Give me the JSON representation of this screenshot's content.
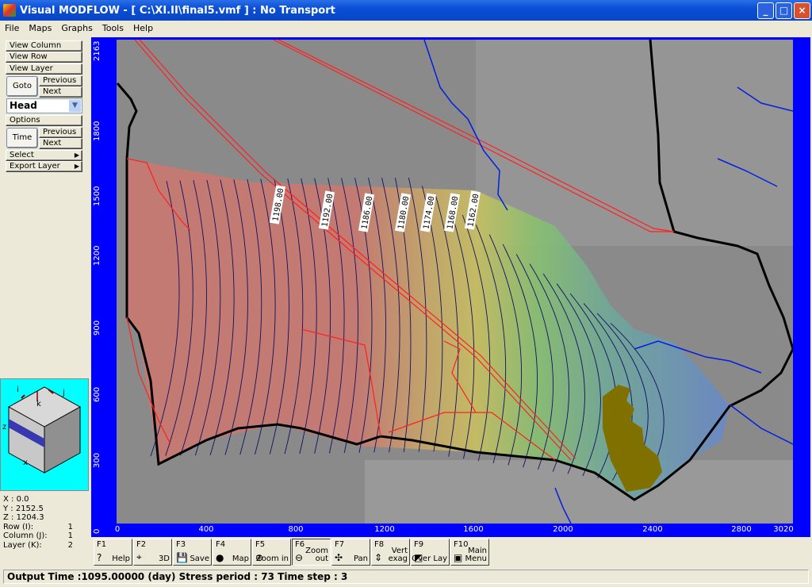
{
  "window": {
    "title": "Visual MODFLOW - [ C:\\XI.II\\final5.vmf ] : No Transport",
    "minimize": "_",
    "maximize": "□",
    "close": "×"
  },
  "menu": [
    "File",
    "Maps",
    "Graphs",
    "Tools",
    "Help"
  ],
  "left_panel": {
    "view_column": "View Column",
    "view_row": "View Row",
    "view_layer": "View Layer",
    "goto": "Goto",
    "previous": "Previous",
    "next": "Next",
    "display_select": "Head",
    "options": "Options",
    "time": "Time",
    "time_previous": "Previous",
    "time_next": "Next",
    "select": "Select",
    "export_layer": "Export Layer"
  },
  "cube_labels": {
    "i": "i",
    "j": "j",
    "k": "k",
    "z": "z",
    "x": "x"
  },
  "coords": {
    "x": "X : 0.0",
    "y": "Y : 2152.5",
    "z": "Z : 1204.3",
    "row_label": "Row   (I):",
    "row": "1",
    "col_label": "Column (J):",
    "col": "1",
    "layer_label": "Layer  (K):",
    "layer": "2"
  },
  "axes": {
    "x_ticks": [
      "0",
      "400",
      "800",
      "1200",
      "1600",
      "2000",
      "2400",
      "2800",
      "3020"
    ],
    "y_ticks": [
      "2163",
      "1800",
      "1500",
      "1200",
      "900",
      "600",
      "300",
      "0"
    ]
  },
  "contour_labels": [
    "1198.00",
    "1192.00",
    "1186.00",
    "1180.00",
    "1174.00",
    "1168.00",
    "1162.00"
  ],
  "colors": {
    "frame": "#0000ff",
    "head_high": "#c87870",
    "head_mid": "#c8b860",
    "head_low": "#7090c8",
    "roads": "#ff2020",
    "rivers": "#0020e0",
    "boundary": "#000000",
    "contours": "#101060"
  },
  "fkeys": [
    {
      "fn": "F1",
      "label": "Help",
      "icon": "help-icon"
    },
    {
      "fn": "F2",
      "label": "3D",
      "icon": "3d-icon"
    },
    {
      "fn": "F3",
      "label": "Save",
      "icon": "save-icon"
    },
    {
      "fn": "F4",
      "label": "Map",
      "icon": "globe-icon"
    },
    {
      "fn": "F5",
      "label": "Zoom in",
      "icon": "zoom-in-icon"
    },
    {
      "fn": "F6",
      "label": "Zoom out",
      "icon": "zoom-out-icon"
    },
    {
      "fn": "F7",
      "label": "Pan",
      "icon": "pan-icon"
    },
    {
      "fn": "F8",
      "label": "Vert exag",
      "icon": "vert-exag-icon"
    },
    {
      "fn": "F9",
      "label": "Over Lay",
      "icon": "overlay-icon"
    },
    {
      "fn": "F10",
      "label": "Main Menu",
      "icon": "main-menu-icon"
    }
  ],
  "status": "Output Time :1095.00000 (day) Stress period : 73 Time step : 3"
}
